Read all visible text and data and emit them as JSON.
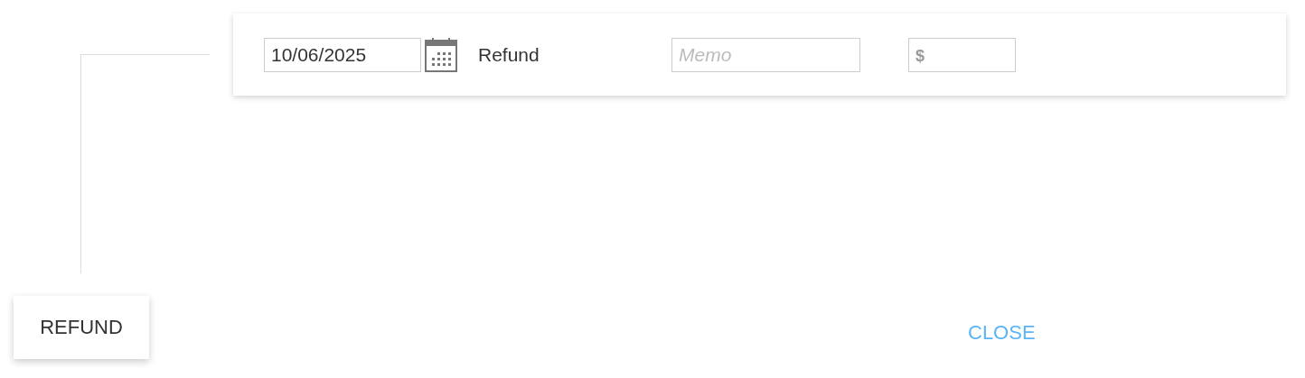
{
  "entry": {
    "date": "10/06/2025",
    "type_label": "Refund",
    "memo": {
      "placeholder": "Memo"
    },
    "amount": {
      "placeholder": "$"
    }
  },
  "buttons": [
    {
      "label": "REFUND",
      "kind": "raised"
    },
    {
      "label": "CLOSE",
      "kind": "flat"
    }
  ]
}
